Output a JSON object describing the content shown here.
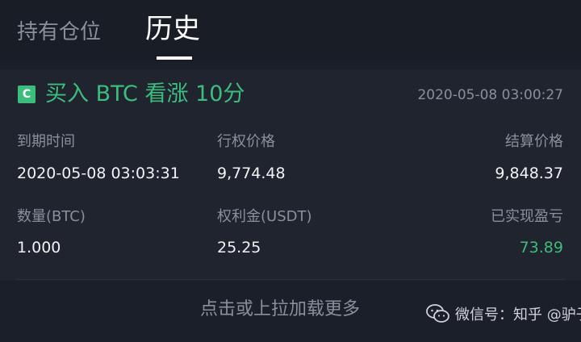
{
  "tabs": [
    {
      "label": "持有仓位",
      "active": false
    },
    {
      "label": "历史",
      "active": true
    }
  ],
  "order": {
    "badge": "C",
    "title": "买入 BTC 看涨 10分",
    "time": "2020-05-08 03:00:27",
    "fields": {
      "expiry": {
        "label": "到期时间",
        "value": "2020-05-08 03:03:31"
      },
      "strike": {
        "label": "行权价格",
        "value": "9,774.48"
      },
      "settle": {
        "label": "结算价格",
        "value": "9,848.37"
      },
      "qty": {
        "label": "数量(BTC)",
        "value": "1.000"
      },
      "premium": {
        "label": "权利金(USDT)",
        "value": "25.25"
      },
      "pnl": {
        "label": "已实现盈亏",
        "value": "73.89"
      }
    }
  },
  "load_more": "点击或上拉加载更多",
  "watermark": "微信号：知乎 @驴子",
  "colors": {
    "background": "#1b1f29",
    "card": "#20242f",
    "accent_green": "#3dbd7d",
    "muted_text": "#8a8f9b"
  },
  "icons": {
    "watermark": "wechat-icon"
  }
}
